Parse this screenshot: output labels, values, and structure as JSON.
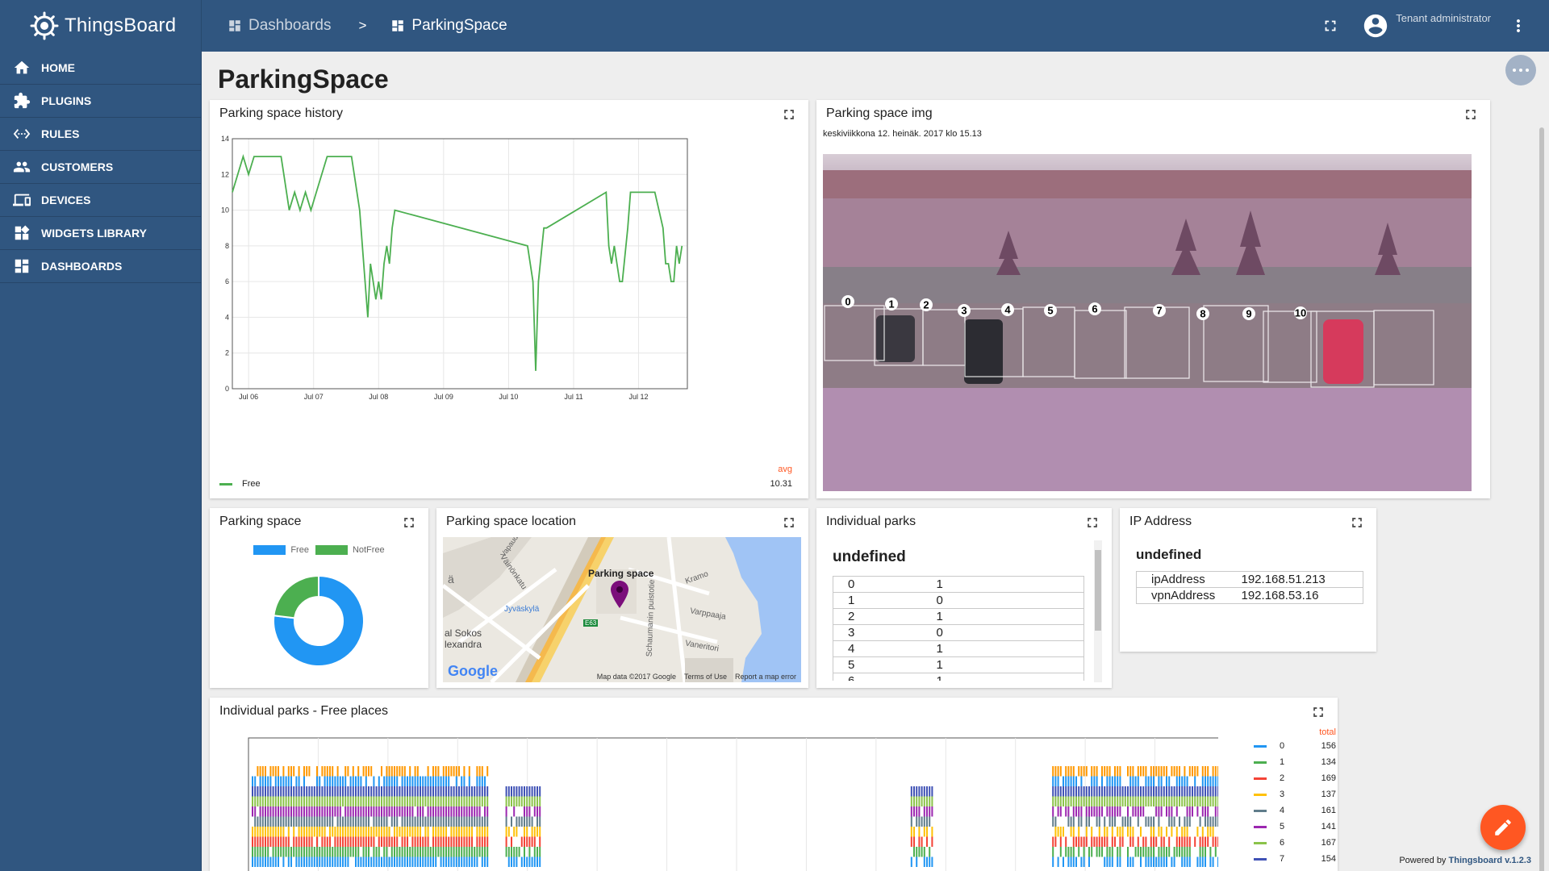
{
  "app": {
    "name": "ThingsBoard"
  },
  "header": {
    "breadcrumbs": [
      "Dashboards",
      "ParkingSpace"
    ],
    "separator": ">",
    "user": "Tenant administrator"
  },
  "sidebar": {
    "items": [
      {
        "label": "HOME",
        "icon": "home-icon"
      },
      {
        "label": "PLUGINS",
        "icon": "puzzle-icon"
      },
      {
        "label": "RULES",
        "icon": "settings-ethernet-icon"
      },
      {
        "label": "CUSTOMERS",
        "icon": "people-icon"
      },
      {
        "label": "DEVICES",
        "icon": "devices-icon"
      },
      {
        "label": "WIDGETS LIBRARY",
        "icon": "widgets-icon"
      },
      {
        "label": "DASHBOARDS",
        "icon": "dashboard-icon"
      }
    ]
  },
  "page": {
    "title": "ParkingSpace"
  },
  "widgets": {
    "history": {
      "title": "Parking space history",
      "legend": "Free",
      "avg_label": "avg",
      "avg_value": "10.31",
      "color": "#4caf50"
    },
    "image": {
      "title": "Parking space img",
      "timestamp": "keskiviikkona 12. heinäk. 2017 klo 15.13",
      "spots": [
        "0",
        "1",
        "2",
        "3",
        "4",
        "5",
        "6",
        "7",
        "8",
        "9",
        "10"
      ]
    },
    "donut": {
      "title": "Parking space",
      "legend": [
        {
          "label": "Free",
          "color": "#2196f3"
        },
        {
          "label": "NotFree",
          "color": "#4caf50"
        }
      ]
    },
    "map": {
      "title": "Parking space location",
      "marker_label": "Parking space",
      "labels": [
        "Väinönkatu",
        "Jyväskylä",
        "al Sokos",
        "lexandra",
        "Kramo",
        "Varppaaja",
        "Vaneritori",
        "Schaumanin puistotie",
        "E63",
        "ä",
        "Vapaudenk"
      ],
      "brand": "Google",
      "footer": [
        "Map data ©2017 Google",
        "Terms of Use",
        "Report a map error"
      ]
    },
    "parks": {
      "title": "Individual parks",
      "heading": "undefined",
      "rows": [
        [
          "0",
          "1"
        ],
        [
          "1",
          "0"
        ],
        [
          "2",
          "1"
        ],
        [
          "3",
          "0"
        ],
        [
          "4",
          "1"
        ],
        [
          "5",
          "1"
        ],
        [
          "6",
          "1"
        ]
      ]
    },
    "ip": {
      "title": "IP Address",
      "heading": "undefined",
      "rows": [
        [
          "ipAddress",
          "192.168.51.213"
        ],
        [
          "vpnAddress",
          "192.168.53.16"
        ]
      ]
    },
    "free_places": {
      "title": "Individual parks - Free places",
      "total_label": "total",
      "series": [
        {
          "name": "0",
          "total": "156",
          "color": "#2196f3"
        },
        {
          "name": "1",
          "total": "134",
          "color": "#4caf50"
        },
        {
          "name": "2",
          "total": "169",
          "color": "#f44336"
        },
        {
          "name": "3",
          "total": "137",
          "color": "#ffc107"
        },
        {
          "name": "4",
          "total": "161",
          "color": "#607d8b"
        },
        {
          "name": "5",
          "total": "141",
          "color": "#9c27b0"
        },
        {
          "name": "6",
          "total": "167",
          "color": "#8bc34a"
        },
        {
          "name": "7",
          "total": "154",
          "color": "#3f51b5"
        }
      ]
    }
  },
  "chart_data": [
    {
      "type": "line",
      "title": "Parking space history",
      "series": [
        {
          "name": "Free",
          "points": [
            [
              "Jul 05 18:00",
              11
            ],
            [
              "Jul 05 20:00",
              12
            ],
            [
              "Jul 05 22:00",
              13
            ],
            [
              "Jul 06 00:00",
              12
            ],
            [
              "Jul 06 02:00",
              13
            ],
            [
              "Jul 06 06:00",
              13
            ],
            [
              "Jul 06 10:00",
              13
            ],
            [
              "Jul 06 12:00",
              13
            ],
            [
              "Jul 06 13:00",
              12
            ],
            [
              "Jul 06 15:00",
              10
            ],
            [
              "Jul 06 17:00",
              11
            ],
            [
              "Jul 06 19:00",
              10
            ],
            [
              "Jul 06 21:00",
              11
            ],
            [
              "Jul 06 23:00",
              10
            ],
            [
              "Jul 07 01:00",
              11
            ],
            [
              "Jul 07 03:00",
              12
            ],
            [
              "Jul 07 05:00",
              13
            ],
            [
              "Jul 07 10:00",
              13
            ],
            [
              "Jul 07 14:00",
              13
            ],
            [
              "Jul 07 17:00",
              10
            ],
            [
              "Jul 07 19:00",
              6
            ],
            [
              "Jul 07 20:00",
              4
            ],
            [
              "Jul 07 21:00",
              7
            ],
            [
              "Jul 07 23:00",
              5
            ],
            [
              "Jul 08 00:00",
              6
            ],
            [
              "Jul 08 01:00",
              5
            ],
            [
              "Jul 08 02:00",
              7
            ],
            [
              "Jul 08 03:00",
              8
            ],
            [
              "Jul 08 04:00",
              7
            ],
            [
              "Jul 08 05:00",
              9
            ],
            [
              "Jul 08 06:00",
              10
            ],
            [
              "Jul 10 07:00",
              8
            ],
            [
              "Jul 10 09:00",
              6
            ],
            [
              "Jul 10 10:00",
              1
            ],
            [
              "Jul 10 11:00",
              6
            ],
            [
              "Jul 10 13:00",
              9
            ],
            [
              "Jul 10 14:00",
              9
            ],
            [
              "Jul 11 12:00",
              11
            ],
            [
              "Jul 11 13:00",
              8
            ],
            [
              "Jul 11 14:00",
              7
            ],
            [
              "Jul 11 15:00",
              8
            ],
            [
              "Jul 11 16:00",
              7
            ],
            [
              "Jul 11 17:00",
              6
            ],
            [
              "Jul 11 18:00",
              6
            ],
            [
              "Jul 11 20:00",
              9
            ],
            [
              "Jul 11 21:00",
              11
            ],
            [
              "Jul 12 03:00",
              11
            ],
            [
              "Jul 12 06:00",
              11
            ],
            [
              "Jul 12 09:00",
              9
            ],
            [
              "Jul 12 10:00",
              7
            ],
            [
              "Jul 12 11:00",
              7
            ],
            [
              "Jul 12 12:00",
              6
            ],
            [
              "Jul 12 13:00",
              6
            ],
            [
              "Jul 12 14:00",
              8
            ],
            [
              "Jul 12 15:00",
              7
            ],
            [
              "Jul 12 16:00",
              8
            ]
          ]
        }
      ],
      "x_ticks": [
        "Jul 06",
        "Jul 07",
        "Jul 08",
        "Jul 09",
        "Jul 10",
        "Jul 11",
        "Jul 12"
      ],
      "y_ticks": [
        "0",
        "2",
        "4",
        "6",
        "8",
        "10",
        "12",
        "14"
      ],
      "ylim": [
        0,
        14
      ],
      "grid": true,
      "legend_position": "bottom-left"
    },
    {
      "type": "pie",
      "title": "Parking space",
      "labels": [
        "Free",
        "NotFree"
      ],
      "values": [
        10,
        3
      ],
      "donut": true
    },
    {
      "type": "bar",
      "title": "Individual parks - Free places",
      "stacked": true,
      "series": [
        "0",
        "1",
        "2",
        "3",
        "4",
        "5",
        "6",
        "7"
      ],
      "totals": [
        156,
        134,
        169,
        137,
        161,
        141,
        167,
        154
      ],
      "activity_ranges": [
        [
          0.0,
          0.245
        ],
        [
          0.26,
          0.3
        ],
        [
          0.675,
          0.7
        ],
        [
          0.82,
          1.0
        ]
      ]
    }
  ]
}
